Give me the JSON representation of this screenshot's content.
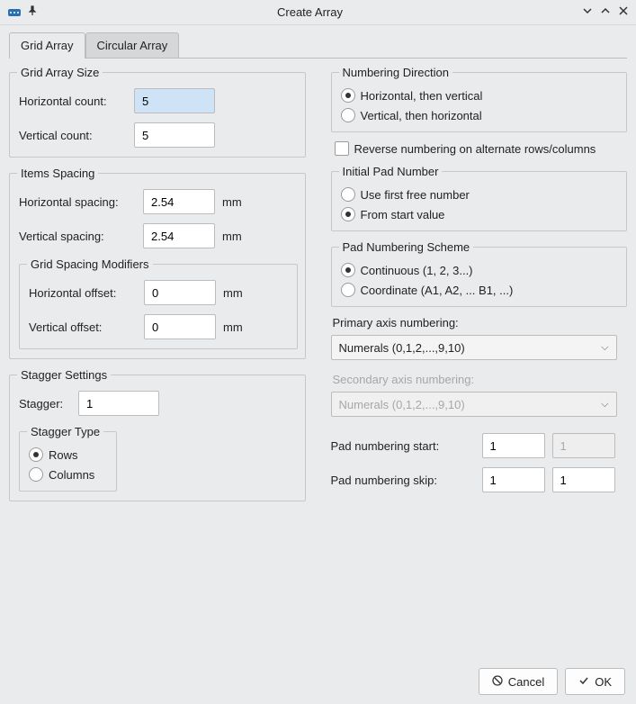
{
  "window": {
    "title": "Create Array"
  },
  "tabs": {
    "grid": "Grid Array",
    "circular": "Circular Array"
  },
  "grid_size": {
    "legend": "Grid Array Size",
    "h_label": "Horizontal count:",
    "h_value": "5",
    "v_label": "Vertical count:",
    "v_value": "5"
  },
  "spacing": {
    "legend": "Items Spacing",
    "h_label": "Horizontal spacing:",
    "h_value": "2.54",
    "v_label": "Vertical spacing:",
    "v_value": "2.54",
    "unit": "mm",
    "modifiers": {
      "legend": "Grid Spacing Modifiers",
      "ho_label": "Horizontal offset:",
      "ho_value": "0",
      "vo_label": "Vertical offset:",
      "vo_value": "0"
    }
  },
  "stagger": {
    "legend": "Stagger Settings",
    "label": "Stagger:",
    "value": "1",
    "type_legend": "Stagger Type",
    "rows": "Rows",
    "columns": "Columns"
  },
  "numdir": {
    "legend": "Numbering Direction",
    "hv": "Horizontal, then vertical",
    "vh": "Vertical, then horizontal"
  },
  "reverse": "Reverse numbering on alternate rows/columns",
  "initial": {
    "legend": "Initial Pad Number",
    "first_free": "Use first free number",
    "from_start": "From start value"
  },
  "scheme": {
    "legend": "Pad Numbering Scheme",
    "continuous": "Continuous (1, 2, 3...)",
    "coordinate": "Coordinate (A1, A2, ... B1, ...)"
  },
  "primary": {
    "label": "Primary axis numbering:",
    "value": "Numerals (0,1,2,...,9,10)"
  },
  "secondary": {
    "label": "Secondary axis numbering:",
    "value": "Numerals (0,1,2,...,9,10)"
  },
  "start": {
    "label": "Pad numbering start:",
    "v1": "1",
    "v2": "1"
  },
  "skip": {
    "label": "Pad numbering skip:",
    "v1": "1",
    "v2": "1"
  },
  "buttons": {
    "cancel": "Cancel",
    "ok": "OK"
  }
}
